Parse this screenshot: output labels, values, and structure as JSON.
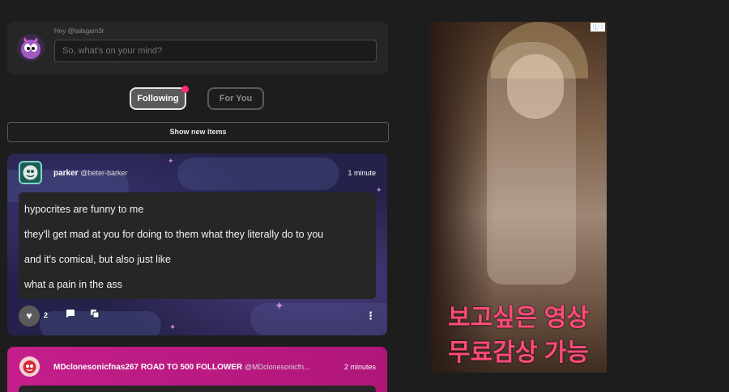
{
  "composer": {
    "greeting": "Hey @tailsgam3r",
    "placeholder": "So, what's on your mind?"
  },
  "tabs": [
    {
      "label": "Following",
      "active": true
    },
    {
      "label": "For You",
      "active": false
    }
  ],
  "feed": {
    "show_new_label": "Show new items"
  },
  "posts": [
    {
      "author": "parker",
      "handle": "@beter-barker",
      "time": "1 minute",
      "lines": [
        "hypocrites are funny to me",
        "they'll get mad at you for doing to them what they literally do to you",
        "and it's comical, but also just like",
        "what a pain in the ass"
      ],
      "likes": "2"
    },
    {
      "author": "MDclonesonicfnas267 ROAD TO 500 FOLLOWER",
      "handle": "@MDclonesonicfn...",
      "time": "2 minutes"
    }
  ],
  "ad": {
    "line1": "보고싶은 영상",
    "line2": "무료감상 가능",
    "info_label": "ⓘ ⁝"
  },
  "icons": {
    "like": "heart-icon",
    "comment": "comment-icon",
    "repost": "repost-icon",
    "more": "more-icon"
  },
  "colors": {
    "background": "#1d1d1d",
    "card": "#262626",
    "notification_dot": "#ff2d6e",
    "post2_accent": "#c41e8a",
    "ad_text": "#ff4a7a"
  }
}
